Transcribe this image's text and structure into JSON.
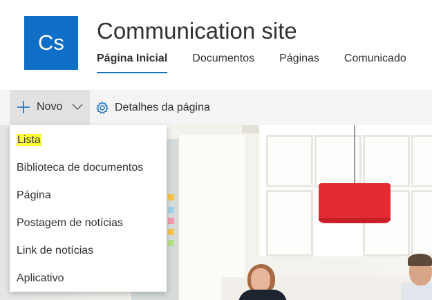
{
  "site": {
    "logo_text": "Cs",
    "title": "Communication site",
    "accent_color": "#0f6fc6"
  },
  "nav": {
    "items": [
      {
        "label": "Página Inicial",
        "active": true
      },
      {
        "label": "Documentos",
        "active": false
      },
      {
        "label": "Páginas",
        "active": false
      },
      {
        "label": "Comunicado",
        "active": false
      }
    ]
  },
  "command_bar": {
    "new_label": "Novo",
    "new_icon": "plus-icon",
    "new_chevron": "chevron-down-icon",
    "details_label": "Detalhes da página",
    "details_icon": "gear-icon"
  },
  "new_menu": {
    "items": [
      {
        "label": "Lista",
        "highlighted": true
      },
      {
        "label": "Biblioteca de documentos"
      },
      {
        "label": "Página"
      },
      {
        "label": "Postagem de notícias"
      },
      {
        "label": "Link de notícias"
      },
      {
        "label": "Aplicativo"
      }
    ],
    "highlight_color": "#ffff33"
  }
}
